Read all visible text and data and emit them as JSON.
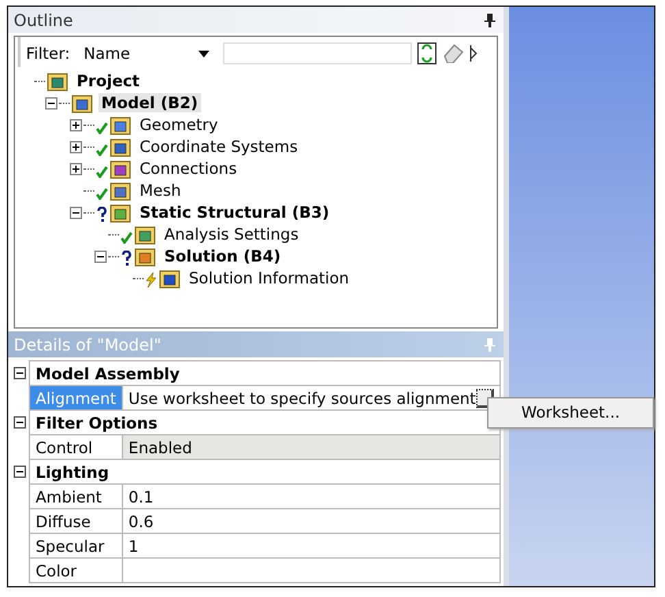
{
  "outline": {
    "title": "Outline",
    "filter": {
      "label": "Filter:",
      "value": "Name"
    },
    "tree": [
      {
        "label": "Project",
        "kind": "project",
        "ok": false,
        "unknown": false,
        "pending": false,
        "bold": true,
        "selected": false,
        "children": [
          {
            "label": "Model (B2)",
            "kind": "model",
            "ok": false,
            "unknown": false,
            "pending": false,
            "bold": true,
            "selected": true,
            "expanded": true,
            "children": [
              {
                "label": "Geometry",
                "kind": "geometry",
                "ok": true,
                "unknown": false,
                "pending": false,
                "bold": false,
                "selected": false,
                "expanded": false
              },
              {
                "label": "Coordinate Systems",
                "kind": "coords",
                "ok": true,
                "unknown": false,
                "pending": false,
                "bold": false,
                "selected": false,
                "expanded": false
              },
              {
                "label": "Connections",
                "kind": "connections",
                "ok": true,
                "unknown": false,
                "pending": false,
                "bold": false,
                "selected": false,
                "expanded": false
              },
              {
                "label": "Mesh",
                "kind": "mesh",
                "ok": true,
                "unknown": false,
                "pending": false,
                "bold": false,
                "selected": false
              },
              {
                "label": "Static Structural (B3)",
                "kind": "analysis",
                "ok": false,
                "unknown": true,
                "pending": false,
                "bold": true,
                "selected": false,
                "expanded": true,
                "children": [
                  {
                    "label": "Analysis Settings",
                    "kind": "settings",
                    "ok": true,
                    "unknown": false,
                    "pending": false,
                    "bold": false,
                    "selected": false
                  },
                  {
                    "label": "Solution (B4)",
                    "kind": "solution",
                    "ok": false,
                    "unknown": true,
                    "pending": false,
                    "bold": true,
                    "selected": false,
                    "expanded": true,
                    "children": [
                      {
                        "label": "Solution Information",
                        "kind": "info",
                        "ok": false,
                        "unknown": false,
                        "pending": true,
                        "bold": false,
                        "selected": false
                      }
                    ]
                  }
                ]
              }
            ]
          }
        ]
      }
    ]
  },
  "details": {
    "title": "Details of \"Model\"",
    "sections": [
      {
        "title": "Model Assembly",
        "expanded": true,
        "rows": [
          {
            "label": "Alignment",
            "value": "Use worksheet to specify sources alignment",
            "selected": true,
            "readonly": false,
            "has_button": true
          }
        ]
      },
      {
        "title": "Filter Options",
        "expanded": true,
        "rows": [
          {
            "label": "Control",
            "value": "Enabled",
            "selected": false,
            "readonly": true,
            "has_button": false
          }
        ]
      },
      {
        "title": "Lighting",
        "expanded": true,
        "rows": [
          {
            "label": "Ambient",
            "value": "0.1",
            "selected": false,
            "readonly": false,
            "has_button": false
          },
          {
            "label": "Diffuse",
            "value": "0.6",
            "selected": false,
            "readonly": false,
            "has_button": false
          },
          {
            "label": "Specular",
            "value": "1",
            "selected": false,
            "readonly": false,
            "has_button": false
          },
          {
            "label": "Color",
            "selected": false,
            "readonly": false,
            "has_button": false
          }
        ]
      }
    ]
  },
  "context_menu": {
    "items": [
      "Worksheet..."
    ]
  }
}
